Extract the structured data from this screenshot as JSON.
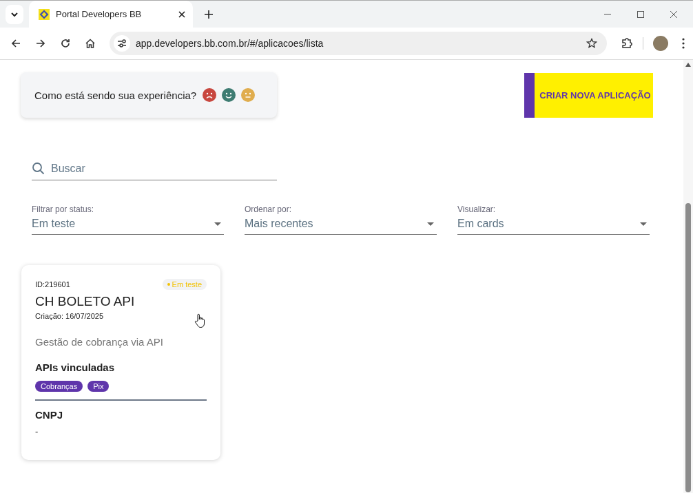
{
  "browser": {
    "tab_title": "Portal Developers BB",
    "url": "app.developers.bb.com.br/#/aplicacoes/lista"
  },
  "feedback": {
    "question": "Como está sendo sua experiência?"
  },
  "create_button": "CRIAR NOVA APLICAÇÃO",
  "search": {
    "placeholder": "Buscar"
  },
  "filters": [
    {
      "label": "Filtrar por status:",
      "value": "Em teste"
    },
    {
      "label": "Ordenar por:",
      "value": "Mais recentes"
    },
    {
      "label": "Visualizar:",
      "value": "Em cards"
    }
  ],
  "cards": [
    {
      "id": "ID:219601",
      "status": "Em teste",
      "color": "#f2c200",
      "title": "CH BOLETO API",
      "created": "Criação: 16/07/2025",
      "description": "Gestão de cobrança via API",
      "apis_heading": "APIs vinculadas",
      "apis": [
        "Cobranças",
        "Pix"
      ],
      "cnpj_heading": "CNPJ",
      "cnpj": "-"
    }
  ]
}
